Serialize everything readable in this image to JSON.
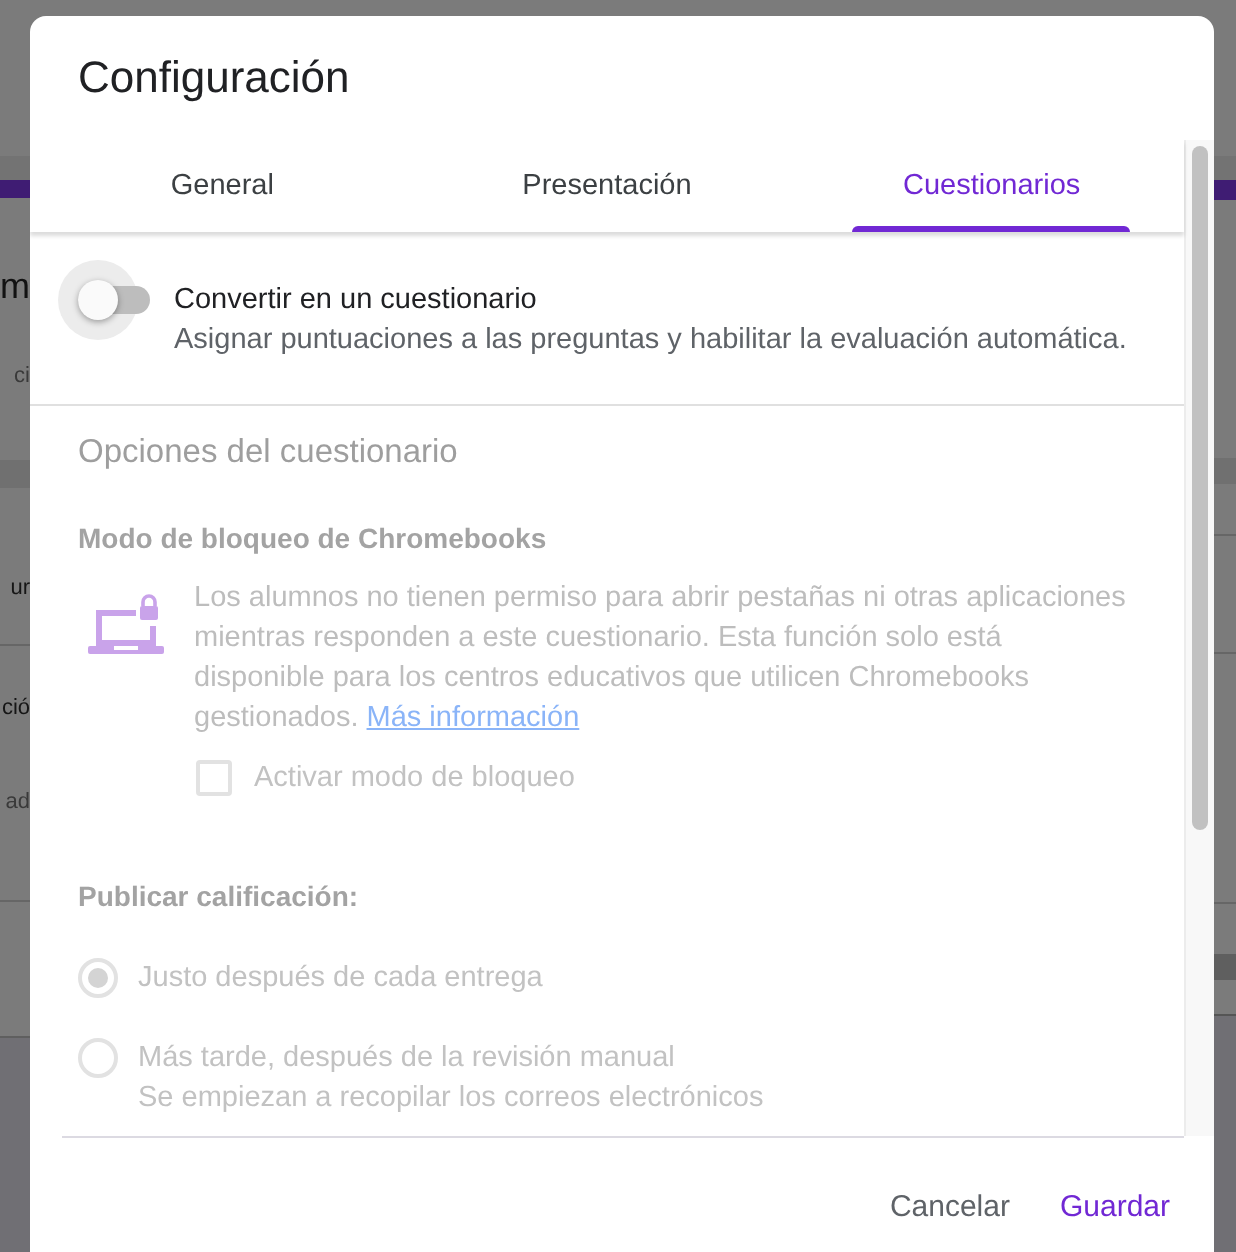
{
  "backdrop": {
    "texts": [
      {
        "text": "m",
        "kind": "title"
      },
      {
        "text": "ci",
        "kind": "caption"
      },
      {
        "text": "ur",
        "kind": "label"
      },
      {
        "text": "ció",
        "kind": "label"
      },
      {
        "text": "ad",
        "kind": "caption"
      }
    ]
  },
  "dialog": {
    "title": "Configuración",
    "tabs": [
      {
        "label": "General",
        "selected": false
      },
      {
        "label": "Presentación",
        "selected": false
      },
      {
        "label": "Cuestionarios",
        "selected": true
      }
    ],
    "quiz_toggle": {
      "on": false,
      "label": "Convertir en un cuestionario",
      "description": "Asignar puntuaciones a las preguntas y habilitar la evaluación automática."
    },
    "quiz_options": {
      "disabled": true,
      "heading": "Opciones del cuestionario",
      "lockdown": {
        "title": "Modo de bloqueo de Chromebooks",
        "description": "Los alumnos no tienen permiso para abrir pestañas ni otras aplicaciones mientras responden a este cuestionario. Esta función solo está disponible para los centros educativos que utilicen Chromebooks gestionados.",
        "link": "Más información",
        "checkbox": {
          "label": "Activar modo de bloqueo",
          "checked": false
        }
      },
      "release_grade": {
        "title": "Publicar calificación:",
        "options": [
          {
            "label": "Justo después de cada entrega",
            "selected": true
          },
          {
            "label": "Más tarde, después de la revisión manual",
            "note": "Se empiezan a recopilar los correos electrónicos",
            "selected": false
          }
        ]
      }
    },
    "buttons": [
      {
        "label": "Cancelar",
        "kind": "secondary"
      },
      {
        "label": "Guardar",
        "kind": "primary"
      }
    ]
  }
}
